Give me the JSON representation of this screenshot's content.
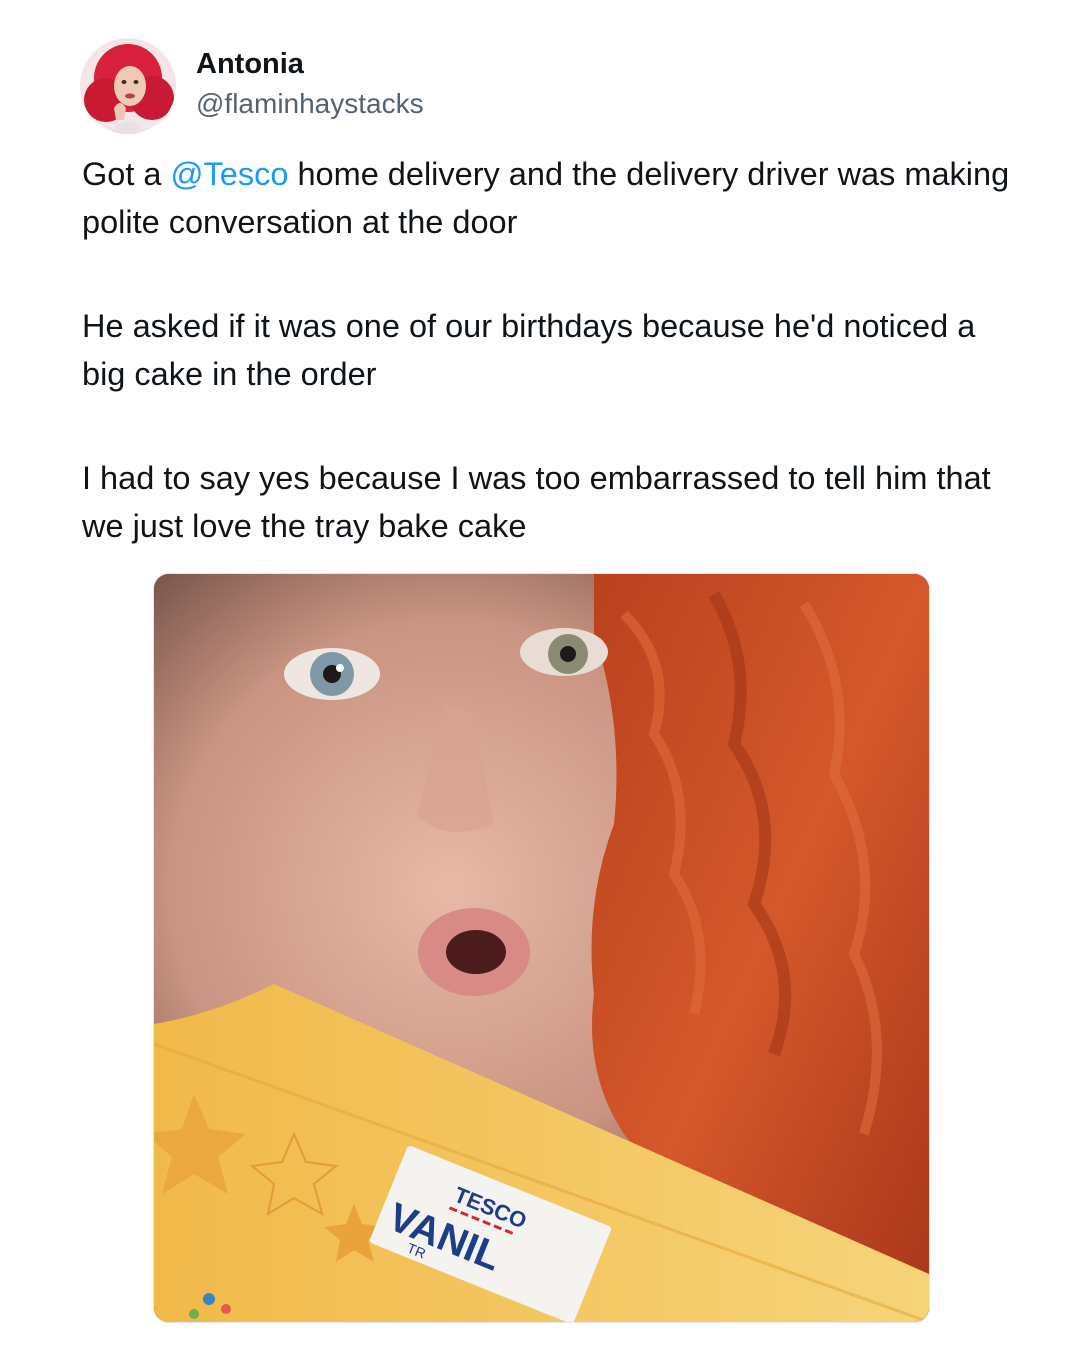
{
  "author": {
    "display_name": "Antonia",
    "handle": "@flaminhaystacks",
    "avatar_icon": "profile-photo"
  },
  "tweet": {
    "paragraph_1": {
      "prefix": "Got a ",
      "mention": "@Tesco",
      "suffix": " home delivery and the delivery driver was making polite conversation at the door"
    },
    "paragraph_2": "He asked if it was one of our birthdays because he'd noticed a big cake in the order",
    "paragraph_3": "I had to say yes because I was too embarrassed to tell him that we just love the tray bake cake"
  },
  "media": {
    "box_brand": "TESCO",
    "box_product": "VANIL",
    "box_subtext": "TR"
  },
  "colors": {
    "link": "#1d9bf0",
    "text": "#0f1419",
    "secondary": "#536471",
    "hair": "#c8461e",
    "box": "#f3c15a"
  }
}
